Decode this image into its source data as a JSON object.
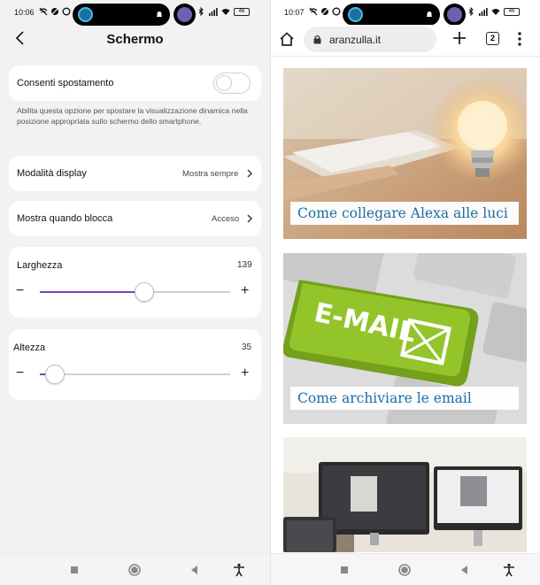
{
  "left": {
    "status": {
      "time": "10:06",
      "battery": "46"
    },
    "header": {
      "title": "Schermo",
      "back_icon": "arrow-left-icon"
    },
    "allow_move": {
      "label": "Consenti spostamento",
      "enabled": false
    },
    "description": "Abilita questa opzione per spostare la visualizzazione dinamica nella posizione appropriata sullo schermo dello smartphone.",
    "display_mode": {
      "label": "Modalità display",
      "value": "Mostra sempre"
    },
    "show_when_locked": {
      "label": "Mostra quando blocca",
      "value": "Acceso"
    },
    "width": {
      "label": "Larghezza",
      "value": "139",
      "level": 0.55
    },
    "height": {
      "label": "Altezza",
      "value": "35",
      "level": 0.08
    }
  },
  "right": {
    "status": {
      "time": "10:07",
      "battery": "46"
    },
    "browser": {
      "host": "aranzulla.it",
      "tab_count": "2"
    },
    "articles": [
      {
        "title": "Come collegare Alexa alle luci"
      },
      {
        "title": "Come archiviare le email",
        "image_text": "E-MAIL"
      },
      {
        "title": ""
      }
    ]
  },
  "colors": {
    "accent": "#7f3fbf",
    "link": "#1a6ea8",
    "background": "#f2f2f2"
  },
  "icons": [
    "arrow-left-icon",
    "chevron-right-icon",
    "home-icon",
    "lock-icon",
    "plus-icon",
    "tabs-icon",
    "more-vert-icon",
    "square-nav-icon",
    "circle-nav-icon",
    "triangle-back-icon",
    "accessibility-icon"
  ]
}
